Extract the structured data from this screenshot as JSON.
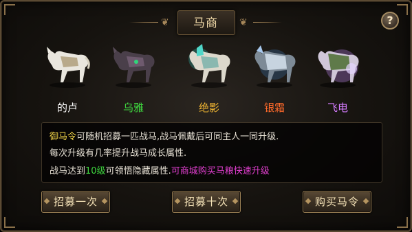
{
  "window": {
    "title": "马商",
    "help_label": "?"
  },
  "horses": [
    {
      "name": "的卢",
      "color": "#ffffff"
    },
    {
      "name": "乌雅",
      "color": "#3fd83f"
    },
    {
      "name": "绝影",
      "color": "#f0b531"
    },
    {
      "name": "银霜",
      "color": "#ff6a2a"
    },
    {
      "name": "飞电",
      "color": "#d57cff"
    }
  ],
  "description": {
    "line1_highlight": "御马令",
    "line1_rest": "可随机招募一匹战马,战马佩戴后可同主人一同升级.",
    "line2": "每次升级有几率提升战马成长属性.",
    "line3_a": "战马达到",
    "line3_level": "10级",
    "line3_b": "可领悟隐藏属性.",
    "line3_promo": "可商城购买马粮快速升级"
  },
  "buttons": {
    "recruit_one": "招募一次",
    "recruit_ten": "招募十次",
    "buy_token": "购买马令"
  }
}
